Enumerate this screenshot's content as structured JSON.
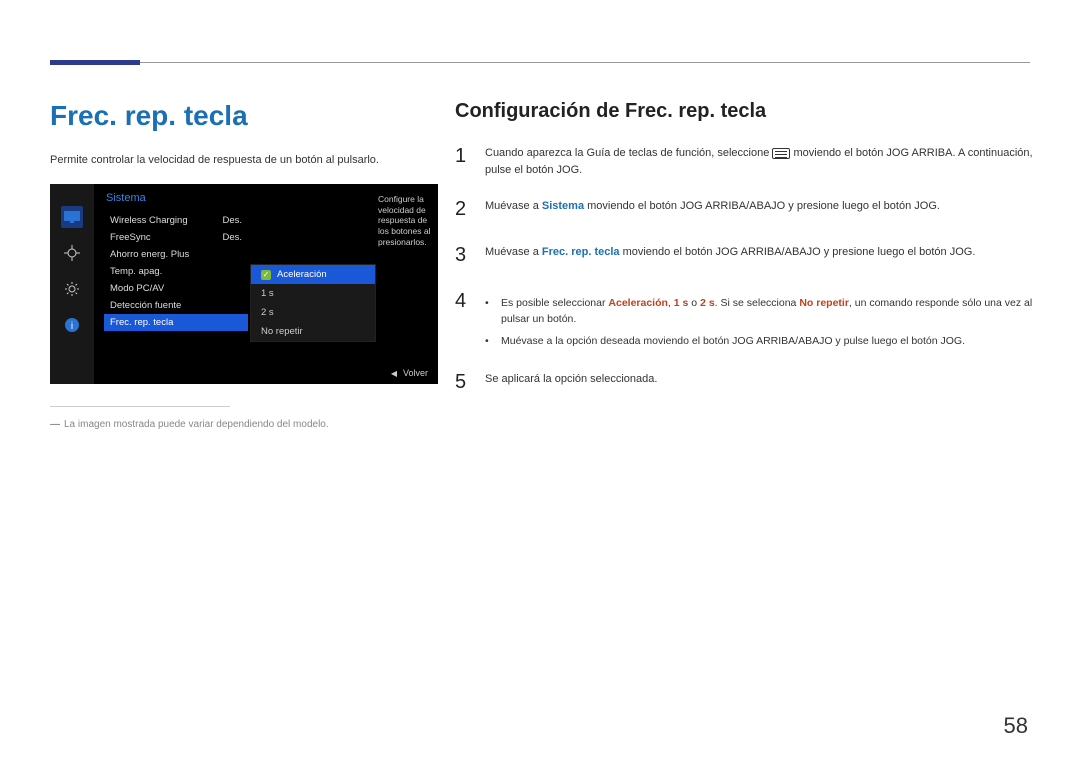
{
  "header": {},
  "left": {
    "title": "Frec. rep. tecla",
    "desc": "Permite controlar la velocidad de respuesta de un botón al pulsarlo.",
    "footnote": "La imagen mostrada puede variar dependiendo del modelo."
  },
  "osd": {
    "menu_title": "Sistema",
    "items": [
      {
        "label": "Wireless Charging",
        "value": "Des."
      },
      {
        "label": "FreeSync",
        "value": "Des."
      },
      {
        "label": "Ahorro energ. Plus",
        "value": ""
      },
      {
        "label": "Temp. apag.",
        "value": ""
      },
      {
        "label": "Modo PC/AV",
        "value": ""
      },
      {
        "label": "Detección fuente",
        "value": ""
      },
      {
        "label": "Frec. rep. tecla",
        "value": ""
      }
    ],
    "active_index": 6,
    "submenu": {
      "selected": "Aceleración",
      "options": [
        "Aceleración",
        "1 s",
        "2 s",
        "No repetir"
      ]
    },
    "help_text": "Configure la velocidad de respuesta de los botones al presionarlos.",
    "back_label": "Volver"
  },
  "right": {
    "title": "Configuración de Frec. rep. tecla",
    "steps": [
      {
        "num": "1",
        "pre": "Cuando aparezca la Guía de teclas de función, seleccione ",
        "post": " moviendo el botón JOG ARRIBA. A continuación, pulse el botón JOG.",
        "has_icon": true
      },
      {
        "num": "2",
        "parts": [
          "Muévase a ",
          {
            "hl": "blue",
            "t": "Sistema"
          },
          " moviendo el botón JOG ARRIBA/ABAJO y presione luego el botón JOG."
        ]
      },
      {
        "num": "3",
        "parts": [
          "Muévase a ",
          {
            "hl": "blue",
            "t": "Frec. rep. tecla"
          },
          " moviendo el botón JOG ARRIBA/ABAJO y presione luego el botón JOG."
        ]
      },
      {
        "num": "4",
        "bullets": [
          {
            "parts": [
              "Es posible seleccionar ",
              {
                "hl": "red",
                "t": "Aceleración"
              },
              ", ",
              {
                "hl": "red",
                "t": "1 s"
              },
              " o ",
              {
                "hl": "red",
                "t": "2 s"
              },
              ". Si se selecciona ",
              {
                "hl": "red",
                "t": "No repetir"
              },
              ", un comando responde sólo una vez al pulsar un botón."
            ]
          },
          {
            "parts": [
              "Muévase a la opción deseada moviendo el botón JOG ARRIBA/ABAJO y pulse luego el botón JOG."
            ]
          }
        ]
      },
      {
        "num": "5",
        "parts": [
          "Se aplicará la opción seleccionada."
        ]
      }
    ]
  },
  "page_number": "58"
}
